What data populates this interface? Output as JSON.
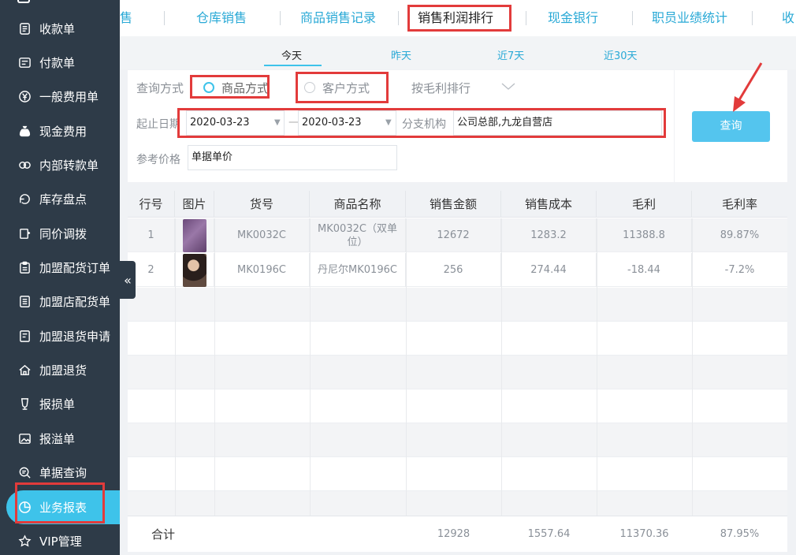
{
  "sidebar": {
    "items": [
      {
        "label": "收款单",
        "icon": "receipt-icon"
      },
      {
        "label": "付款单",
        "icon": "payment-icon"
      },
      {
        "label": "一般费用单",
        "icon": "yen-icon"
      },
      {
        "label": "现金费用",
        "icon": "money-bag-icon"
      },
      {
        "label": "内部转款单",
        "icon": "transfer-icon"
      },
      {
        "label": "库存盘点",
        "icon": "inventory-icon"
      },
      {
        "label": "同价调拨",
        "icon": "allocate-icon"
      },
      {
        "label": "加盟配货订单",
        "icon": "clipboard-icon"
      },
      {
        "label": "加盟店配货单",
        "icon": "list-icon"
      },
      {
        "label": "加盟退货申请",
        "icon": "return-request-icon"
      },
      {
        "label": "加盟退货",
        "icon": "home-icon"
      },
      {
        "label": "报损单",
        "icon": "broken-glass-icon"
      },
      {
        "label": "报溢单",
        "icon": "image-icon"
      },
      {
        "label": "单据查询",
        "icon": "search-doc-icon"
      },
      {
        "label": "业务报表",
        "icon": "pie-chart-icon"
      },
      {
        "label": "VIP管理",
        "icon": "star-icon"
      }
    ],
    "active_index": 14
  },
  "tabs": {
    "items": [
      "售",
      "仓库销售",
      "商品销售记录",
      "销售利润排行",
      "现金银行",
      "职员业绩统计",
      "收"
    ],
    "active": "销售利润排行"
  },
  "date_tabs": {
    "items": [
      "今天",
      "昨天",
      "近7天",
      "近30天"
    ],
    "active": "今天"
  },
  "filter": {
    "query_mode_label": "查询方式",
    "mode_product": "商品方式",
    "mode_customer": "客户方式",
    "sort_label": "按毛利排行",
    "date_label": "起止日期",
    "date_start": "2020-03-23",
    "date_sep": "—",
    "date_end": "2020-03-23",
    "branch_label": "分支机构",
    "branch_value": "公司总部,九龙自营店",
    "ref_price_label": "参考价格",
    "ref_price_value": "单据单价",
    "query_button": "查询"
  },
  "table": {
    "headers": [
      "行号",
      "图片",
      "货号",
      "商品名称",
      "销售金额",
      "销售成本",
      "毛利",
      "毛利率"
    ],
    "rows": [
      {
        "no": "1",
        "code": "MK0032C",
        "name": "MK0032C（双单位）",
        "amount": "12672",
        "cost": "1283.2",
        "profit": "11388.8",
        "rate": "89.87%"
      },
      {
        "no": "2",
        "code": "MK0196C",
        "name": "丹尼尔MK0196C",
        "amount": "256",
        "cost": "274.44",
        "profit": "-18.44",
        "rate": "-7.2%"
      }
    ],
    "footer": {
      "label": "合计",
      "amount": "12928",
      "cost": "1557.64",
      "profit": "11370.36",
      "rate": "87.95%"
    }
  },
  "colors": {
    "sidebar_bg": "#2e3b48",
    "accent": "#3ec3ea",
    "annotation": "#e23b3b"
  }
}
